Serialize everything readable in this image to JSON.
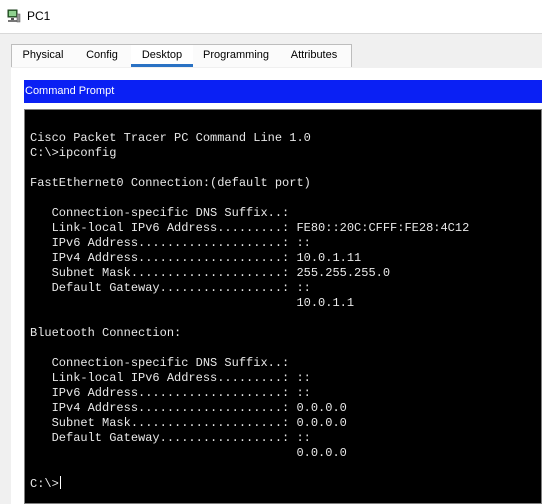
{
  "window": {
    "title": "PC1",
    "icon": "pc-computer-icon"
  },
  "tabs": [
    {
      "label": "Physical"
    },
    {
      "label": "Config"
    },
    {
      "label": "Desktop",
      "active": true
    },
    {
      "label": "Programming"
    },
    {
      "label": "Attributes"
    }
  ],
  "command_prompt": {
    "title": "Command Prompt",
    "header_color": "#0a20f4",
    "lines": [
      "Cisco Packet Tracer PC Command Line 1.0",
      "C:\\>ipconfig",
      "",
      "FastEthernet0 Connection:(default port)",
      "",
      "   Connection-specific DNS Suffix..:",
      "   Link-local IPv6 Address.........: FE80::20C:CFFF:FE28:4C12",
      "   IPv6 Address....................: ::",
      "   IPv4 Address....................: 10.0.1.11",
      "   Subnet Mask.....................: 255.255.255.0",
      "   Default Gateway.................: ::",
      "                                     10.0.1.1",
      "",
      "Bluetooth Connection:",
      "",
      "   Connection-specific DNS Suffix..:",
      "   Link-local IPv6 Address.........: ::",
      "   IPv6 Address....................: ::",
      "   IPv4 Address....................: 0.0.0.0",
      "   Subnet Mask.....................: 0.0.0.0",
      "   Default Gateway.................: ::",
      "                                     0.0.0.0",
      "",
      "C:\\>"
    ]
  }
}
